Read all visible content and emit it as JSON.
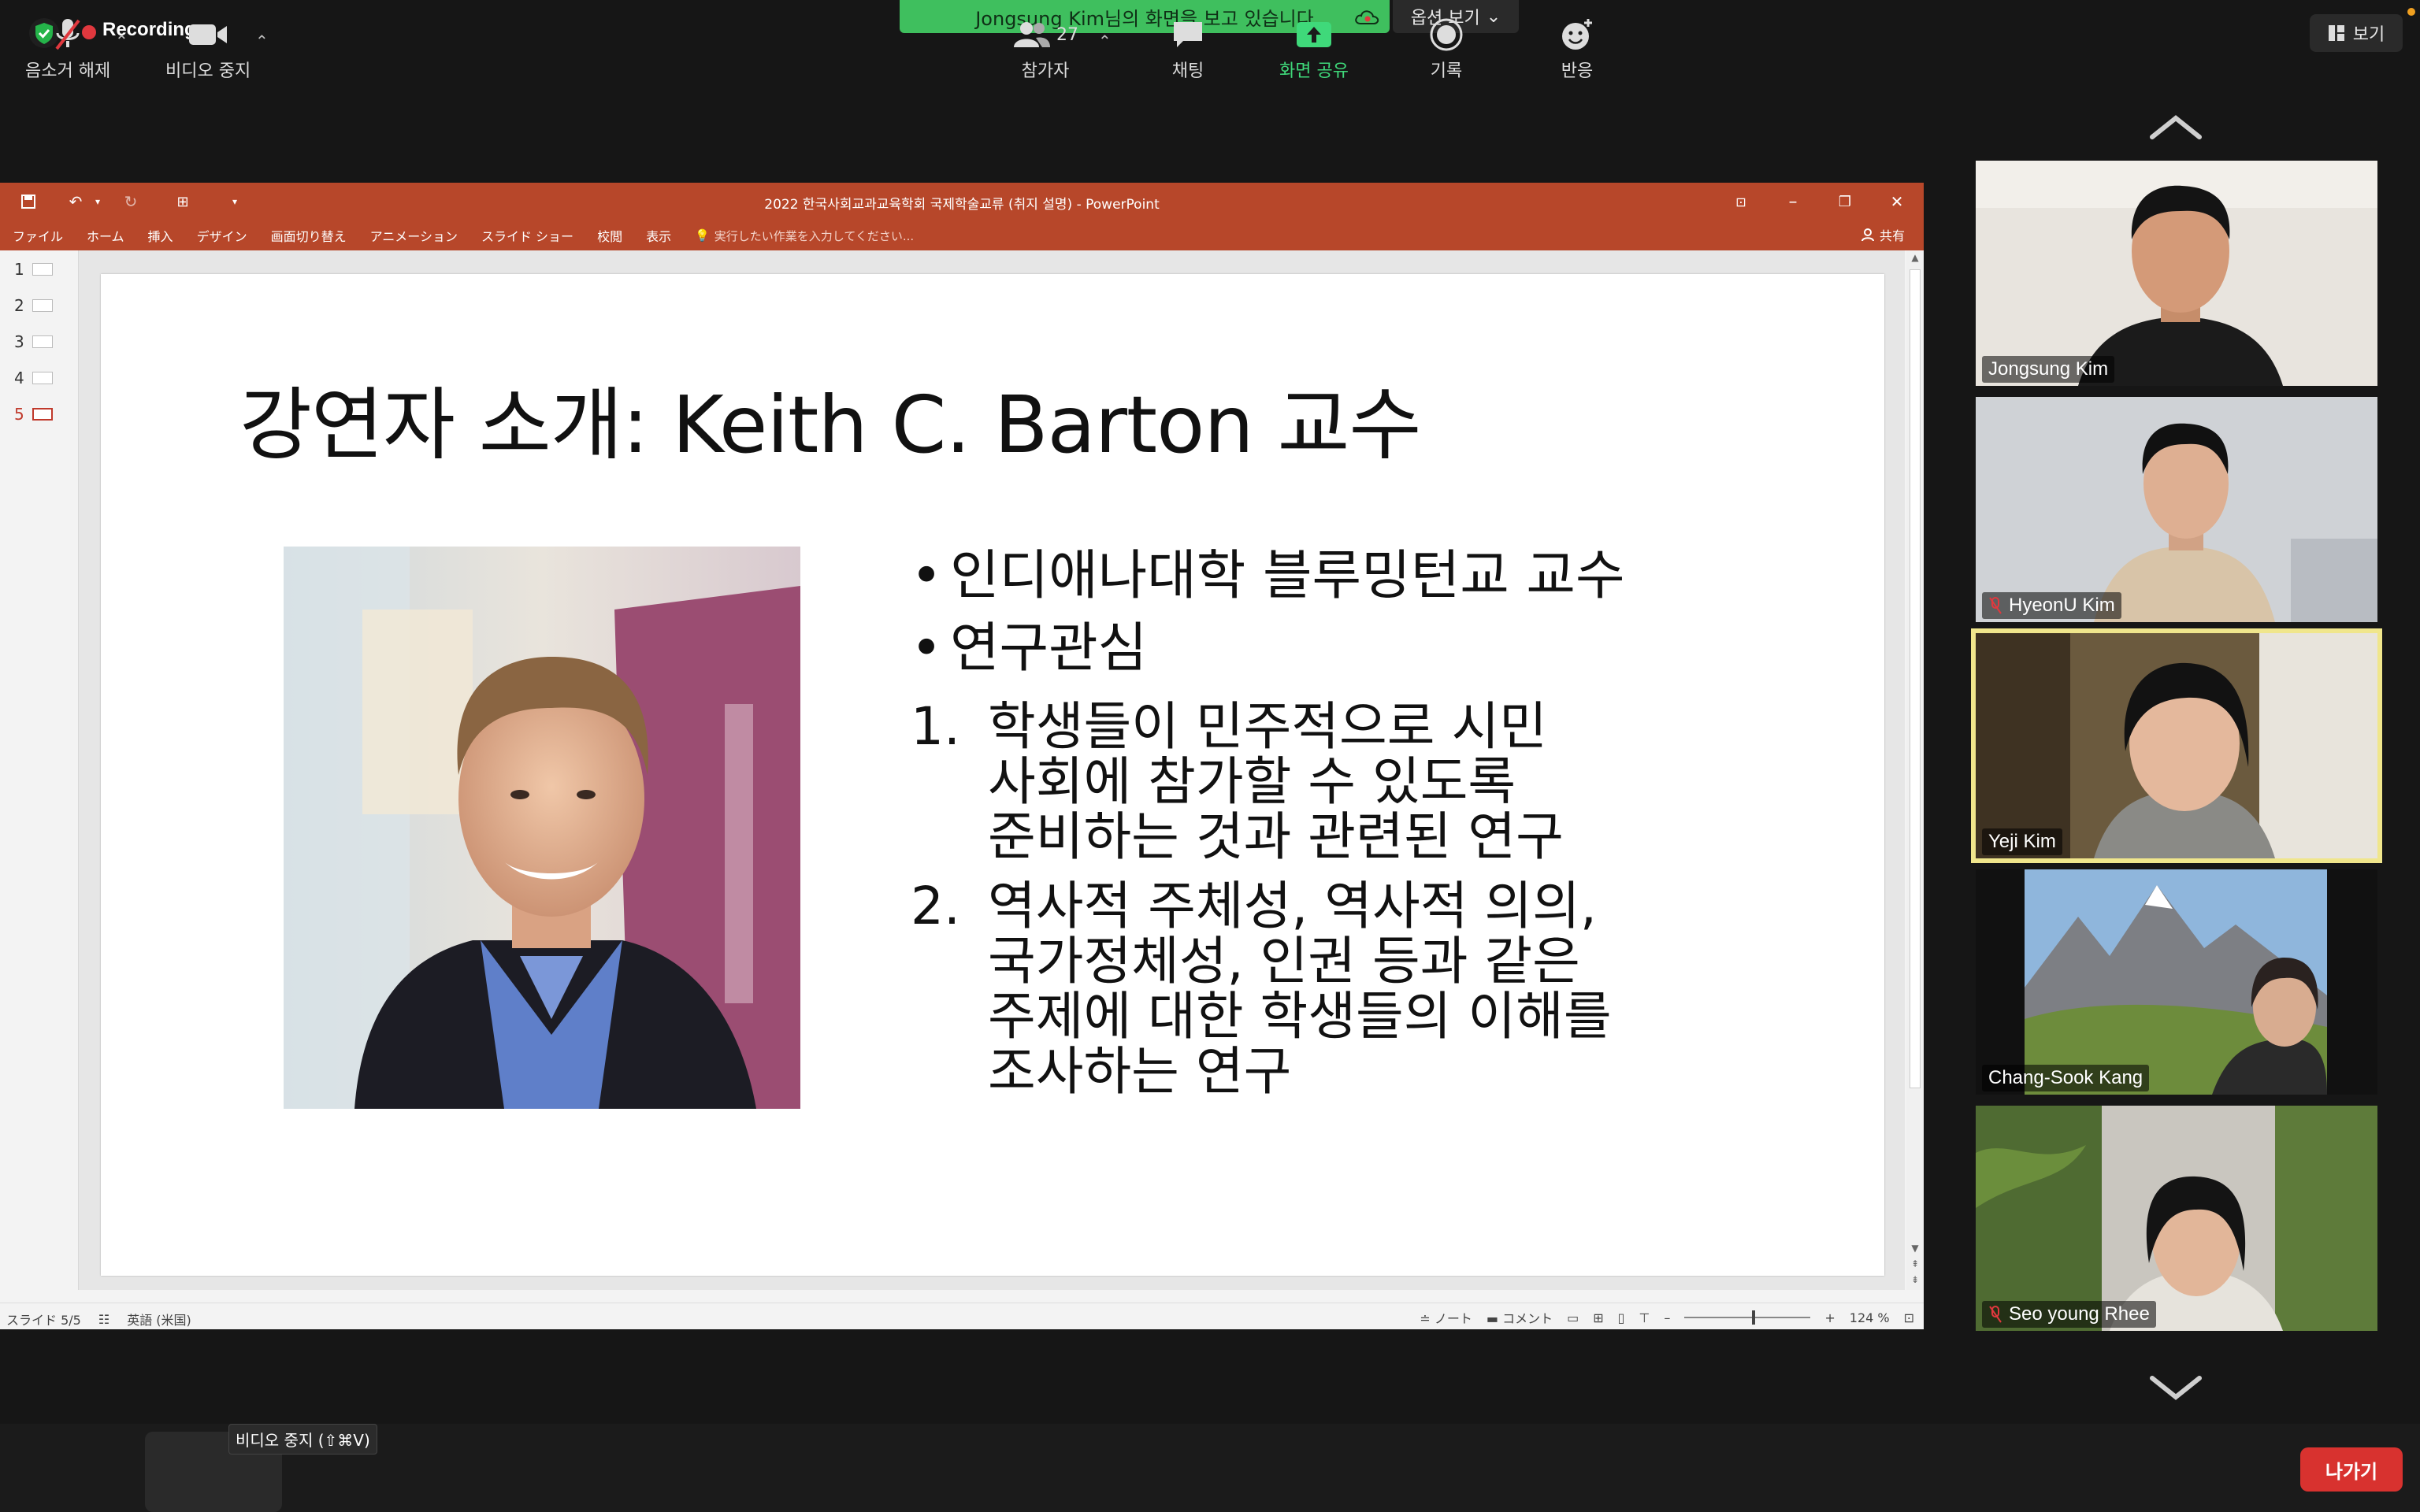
{
  "top_bar": {
    "recording_label": "Recording",
    "share_banner": "Jongsung Kim님의 화면을 보고 있습니다",
    "view_options": "옵션 보기",
    "view_button": "보기"
  },
  "powerpoint": {
    "window_title": "2022 한국사회교과교육학회 국제학술교류 (취지 설명) - PowerPoint",
    "ribbon_tabs": [
      "ファイル",
      "ホーム",
      "挿入",
      "デザイン",
      "画面切り替え",
      "アニメーション",
      "スライド ショー",
      "校閲",
      "表示"
    ],
    "tell_me": "実行したい作業を入力してください...",
    "share": "共有",
    "thumbnails": [
      "1",
      "2",
      "3",
      "4",
      "5"
    ],
    "active_slide": 5,
    "status": {
      "slide": "スライド 5/5",
      "language": "英語 (米国)",
      "notes": "ノート",
      "comments": "コメント",
      "zoom": "124 %"
    }
  },
  "slide": {
    "title": "강연자 소개: Keith C. Barton 교수",
    "bullets": [
      "인디애나대학 블루밍턴교 교수",
      "연구관심"
    ],
    "numbered": [
      {
        "num": "1.",
        "lines": [
          "학생들이 민주적으로 시민",
          "사회에 참가할 수 있도록",
          "준비하는 것과 관련된 연구"
        ]
      },
      {
        "num": "2.",
        "lines": [
          "역사적 주체성, 역사적 의의,",
          "국가정체성, 인권 등과 같은",
          "주제에 대한 학생들의 이해를",
          "조사하는 연구"
        ]
      }
    ]
  },
  "participants": [
    {
      "name": "Jongsung Kim",
      "muted": false,
      "active": false
    },
    {
      "name": "HyeonU Kim",
      "muted": true,
      "active": false
    },
    {
      "name": "Yeji Kim",
      "muted": false,
      "active": true
    },
    {
      "name": "Chang-Sook Kang",
      "muted": false,
      "active": false
    },
    {
      "name": "Seo young Rhee",
      "muted": true,
      "active": false
    }
  ],
  "toolbar": {
    "unmute": "음소거 해제",
    "stop_video": "비디오 중지",
    "tooltip": "비디오 중지 (⇧⌘V)",
    "participants": "참가자",
    "participants_count": "27",
    "chat": "채팅",
    "share_screen": "화면 공유",
    "record": "기록",
    "reactions": "반응",
    "leave": "나가기"
  },
  "colors": {
    "ppt_accent": "#b7472a",
    "share_green": "#3fbf5e",
    "leave_red": "#d8322f",
    "active_speaker": "#f0e68c"
  }
}
